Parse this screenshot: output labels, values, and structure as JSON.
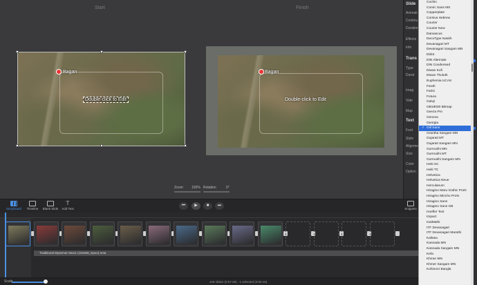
{
  "canvas": {
    "start_label": "Start",
    "finish_label": "Finish",
    "place_name": "Bagan",
    "caption_text": "Double-click to Edit",
    "zoom_label": "Zoom",
    "zoom_value": "100%",
    "rotation_label": "Rotation",
    "rotation_value": "0°"
  },
  "inspector": {
    "slide_header": "Slide",
    "animation": "Animati",
    "continuous": "Continu",
    "duration": "Duration",
    "effects": "Effects",
    "info": "Info",
    "transitions_header": "Trans",
    "type": "Type",
    "duration2": "Durat",
    "image": "Imag",
    "video": "Vide",
    "map": "Map",
    "text_header": "Text",
    "font": "Font",
    "style": "Style",
    "alignment": "Alignme",
    "size": "Size",
    "color": "Color",
    "options": "Option"
  },
  "font_menu": {
    "items": [
      "Cochin",
      "Comic Sans MS",
      "Copperplate",
      "Corsiva Hebrew",
      "Courier",
      "Courier New",
      "Damascus",
      "DecoType Naskh",
      "Devanagari MT",
      "Devanagari Sangam MN",
      "Didot",
      "DIN Alternate",
      "DIN Condensed",
      "Diwan Kufi",
      "Diwan Thuluth",
      "Euphemia UCAS",
      "Farah",
      "Farisi",
      "Futura",
      "Galvji",
      "GB18030 Bitmap",
      "Geeza Pro",
      "Geneva",
      "Georgia",
      "Gill Sans",
      "Grantha Sangam MN",
      "Gujarati MT",
      "Gujarati Sangam MN",
      "Gurmukhi MN",
      "Gurmukhi MT",
      "Gurmukhi Sangam MN",
      "Heiti SC",
      "Heiti TC",
      "Helvetica",
      "Helvetica Neue",
      "Herculanum",
      "Hiragino Maru Gothic ProN",
      "Hiragino Mincho ProN",
      "Hiragino Sans",
      "Hiragino Sans GB",
      "Hoefler Text",
      "Impact",
      "InaiMathi",
      "ITF Devanagari",
      "ITF Devanagari Marathi",
      "Kailasa",
      "Kannada MN",
      "Kannada Sangam MN",
      "Kefa",
      "Khmer MN",
      "Khmer Sangam MN",
      "Kohinoor Bangla"
    ],
    "selected": "Gill Sans",
    "checkmark": "✓"
  },
  "toolbar": {
    "storyboard": "Storyboard",
    "timeline": "Timeline",
    "blank_slide": "Blank Slide",
    "add_text": "Add Text",
    "snippets": "Snippets",
    "prev": "⏮",
    "stop": "■",
    "play": "▶",
    "next": "⏭"
  },
  "timeline": {
    "audio_label": "Traditional Myanmar Music (153468_Dpuo).m4a",
    "slot_colors": [
      "#7f7a5c",
      "#8a3b3a",
      "#6e4a3a",
      "#4d5e3d",
      "#6a5e4a",
      "#8a6a7a",
      "#4a6a8a",
      "#5a7a5a",
      "#6a6a8a",
      "#4a8a6a"
    ]
  },
  "status": {
    "scale_label": "Scale",
    "status_text": "428 slides (0:57:29) - 1 selected (0:00:16)"
  }
}
